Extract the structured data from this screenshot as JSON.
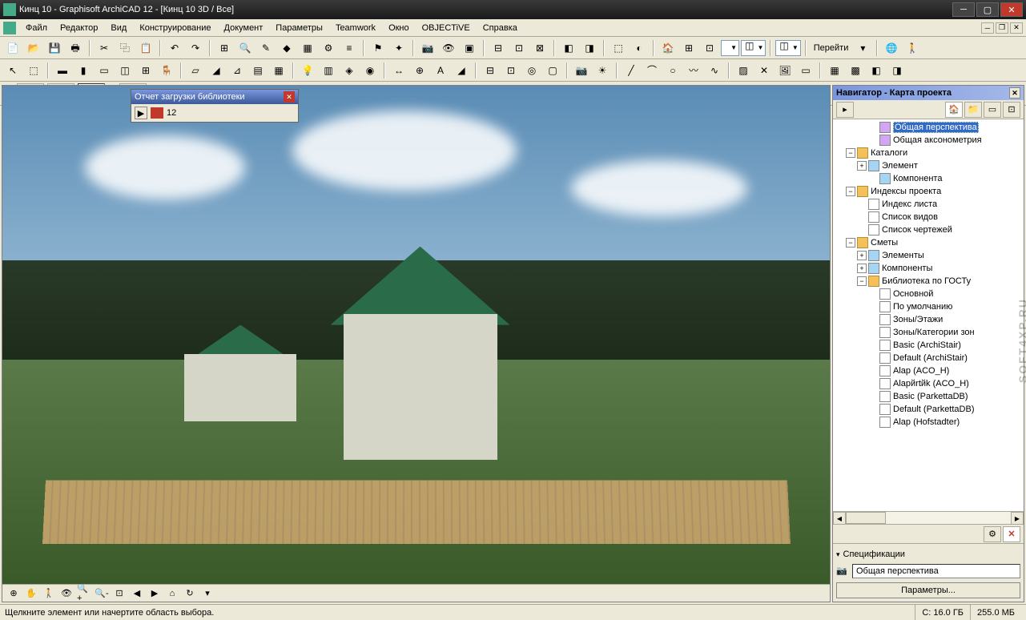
{
  "title": "Кинц 10 - Graphisoft ArchiCAD 12 - [Кинц 10 3D / Все]",
  "menu": [
    "Файл",
    "Редактор",
    "Вид",
    "Конструирование",
    "Документ",
    "Параметры",
    "Teamwork",
    "Окно",
    "OBJECTiVE",
    "Справка"
  ],
  "toolbar_go": "Перейти",
  "report": {
    "title": "Отчет загрузки библиотеки",
    "count": "12"
  },
  "navigator": {
    "title": "Навигатор - Карта проекта",
    "items": [
      {
        "indent": 3,
        "exp": "",
        "icon": "cube",
        "label": "Общая перспектива",
        "selected": true
      },
      {
        "indent": 3,
        "exp": "",
        "icon": "cube",
        "label": "Общая аксонометрия"
      },
      {
        "indent": 1,
        "exp": "−",
        "icon": "folder",
        "label": "Каталоги"
      },
      {
        "indent": 2,
        "exp": "+",
        "icon": "list",
        "label": "Элемент"
      },
      {
        "indent": 3,
        "exp": "",
        "icon": "list",
        "label": "Компонента"
      },
      {
        "indent": 1,
        "exp": "−",
        "icon": "folder",
        "label": "Индексы проекта"
      },
      {
        "indent": 2,
        "exp": "",
        "icon": "page",
        "label": "Индекс листа"
      },
      {
        "indent": 2,
        "exp": "",
        "icon": "page",
        "label": "Список видов"
      },
      {
        "indent": 2,
        "exp": "",
        "icon": "page",
        "label": "Список чертежей"
      },
      {
        "indent": 1,
        "exp": "−",
        "icon": "folder",
        "label": "Сметы"
      },
      {
        "indent": 2,
        "exp": "+",
        "icon": "list",
        "label": "Элементы"
      },
      {
        "indent": 2,
        "exp": "+",
        "icon": "list",
        "label": "Компоненты"
      },
      {
        "indent": 2,
        "exp": "−",
        "icon": "folder",
        "label": "Библиотека по ГОСТу"
      },
      {
        "indent": 3,
        "exp": "",
        "icon": "page",
        "label": "Основной"
      },
      {
        "indent": 3,
        "exp": "",
        "icon": "page",
        "label": "По умолчанию"
      },
      {
        "indent": 3,
        "exp": "",
        "icon": "page",
        "label": "Зоны/Этажи"
      },
      {
        "indent": 3,
        "exp": "",
        "icon": "page",
        "label": "Зоны/Категории зон"
      },
      {
        "indent": 3,
        "exp": "",
        "icon": "page",
        "label": "Basic (ArchiStair)"
      },
      {
        "indent": 3,
        "exp": "",
        "icon": "page",
        "label": "Default (ArchiStair)"
      },
      {
        "indent": 3,
        "exp": "",
        "icon": "page",
        "label": "Alap (ACO_H)"
      },
      {
        "indent": 3,
        "exp": "",
        "icon": "page",
        "label": "Alapйrtйk (ACO_H)"
      },
      {
        "indent": 3,
        "exp": "",
        "icon": "page",
        "label": "Basic (ParkettaDB)"
      },
      {
        "indent": 3,
        "exp": "",
        "icon": "page",
        "label": "Default (ParkettaDB)"
      },
      {
        "indent": 3,
        "exp": "",
        "icon": "page",
        "label": "Alap (Hofstadter)"
      }
    ],
    "spec_label": "Спецификации",
    "spec_value": "Общая перспектива",
    "spec_button": "Параметры..."
  },
  "statusbar": {
    "hint": "Щелкните элемент или начертите область выбора.",
    "disk_c": "C: 16.0 ГБ",
    "mem": "255.0 МБ"
  },
  "watermark": "SOFT4XP.RU"
}
